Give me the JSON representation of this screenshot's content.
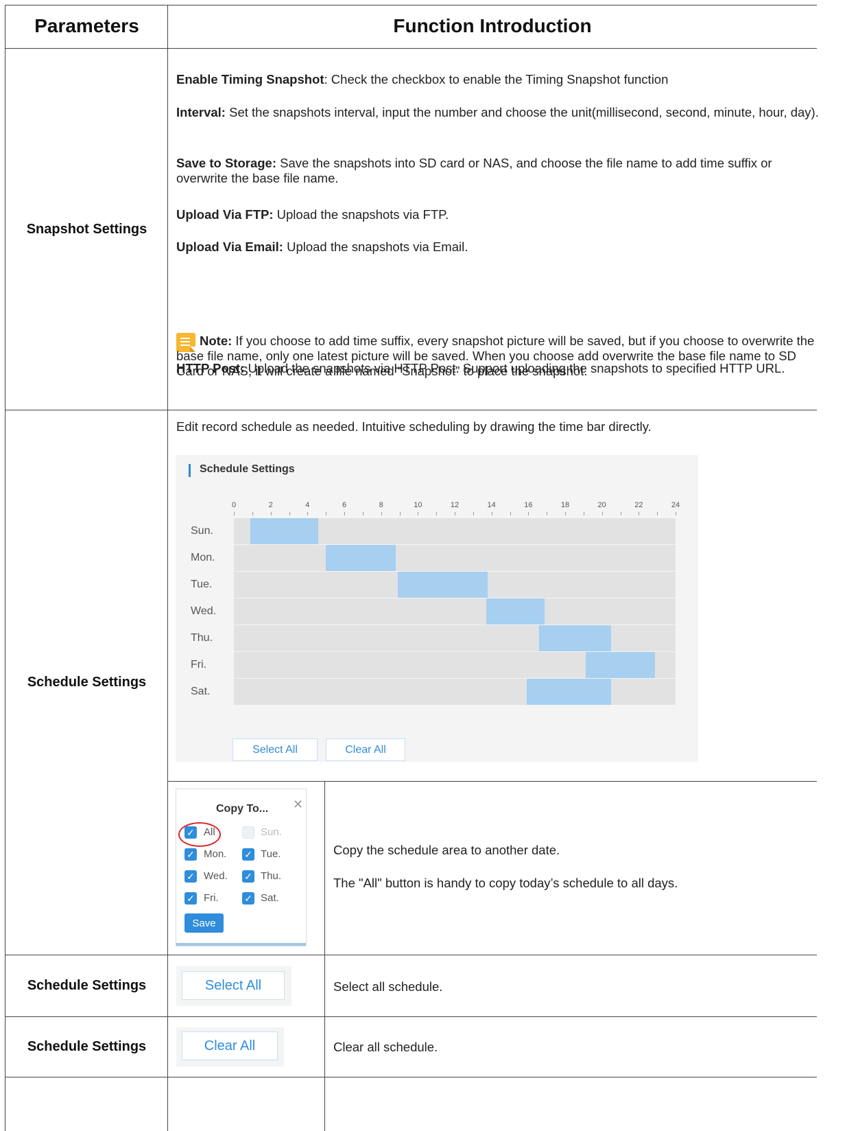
{
  "header": {
    "parameters": "Parameters",
    "function_introduction": "Function Introduction"
  },
  "rows": {
    "snapshot": {
      "param": "Snapshot Settings",
      "items": [
        {
          "term": "Enable Timing Snapshot",
          "text": ": Check the checkbox to enable the Timing Snapshot function"
        },
        {
          "term": "Interval:",
          "text": " Set the snapshots interval, input the number and choose the unit(millisecond, second, minute, hour, day)."
        },
        {
          "term": "Save to Storage:",
          "text": " Save the snapshots into SD card or NAS, and choose the file name to add time suffix or overwrite the base file name."
        },
        {
          "term": "Upload Via FTP:",
          "text": " Upload the snapshots via FTP."
        },
        {
          "term": "Upload Via Email:",
          "text": " Upload the snapshots via Email."
        }
      ],
      "note": {
        "term": "Note:",
        "text": "  If you choose to add time suffix, every snapshot picture will be saved, but if you choose to overwrite the base file name, only one latest picture will be saved. When you choose add overwrite the base file name to SD Card or NAS, it will create a file named “Snapshot” to place the snapshot.",
        "icon": "note-icon"
      },
      "http_post": {
        "term": "HTTP Post:",
        "text": " Upload the snapshots via HTTP Post. Support uploading the snapshots to specified HTTP URL."
      }
    },
    "schedule": {
      "param": "Schedule Settings",
      "intro": "Edit record schedule as needed. Intuitive scheduling by drawing the time bar directly.",
      "panel": {
        "title": "Schedule Settings",
        "hour_ticks": [
          "0",
          "2",
          "4",
          "6",
          "8",
          "10",
          "12",
          "14",
          "16",
          "18",
          "20",
          "22",
          "24"
        ],
        "days": [
          {
            "label": "Sun.",
            "start": 0.9,
            "end": 4.6
          },
          {
            "label": "Mon.",
            "start": 5.0,
            "end": 8.8
          },
          {
            "label": "Tue.",
            "start": 8.9,
            "end": 13.8
          },
          {
            "label": "Wed.",
            "start": 13.7,
            "end": 16.9
          },
          {
            "label": "Thu.",
            "start": 16.6,
            "end": 20.5
          },
          {
            "label": "Fri.",
            "start": 19.1,
            "end": 22.9
          },
          {
            "label": "Sat.",
            "start": 15.9,
            "end": 20.5
          }
        ],
        "select_all": "Select All",
        "clear_all": "Clear All"
      },
      "copy": {
        "title": "Copy To...",
        "close_icon": "close-icon",
        "options": [
          {
            "label": "All",
            "checked": true
          },
          {
            "label": "Sun.",
            "checked": false,
            "disabled": true
          },
          {
            "label": "Mon.",
            "checked": true
          },
          {
            "label": "Tue.",
            "checked": true
          },
          {
            "label": "Wed.",
            "checked": true
          },
          {
            "label": "Thu.",
            "checked": true
          },
          {
            "label": "Fri.",
            "checked": true
          },
          {
            "label": "Sat.",
            "checked": true
          }
        ],
        "save": "Save",
        "desc1": "Copy the schedule area to another date.",
        "desc2": "The \"All\" button is handy to copy today’s schedule to all days."
      }
    },
    "select_all_row": {
      "param": "Schedule Settings",
      "button": "Select All",
      "desc": "Select all schedule."
    },
    "clear_all_row": {
      "param": "Schedule Settings",
      "button": "Clear All",
      "desc": "Clear all schedule."
    }
  }
}
